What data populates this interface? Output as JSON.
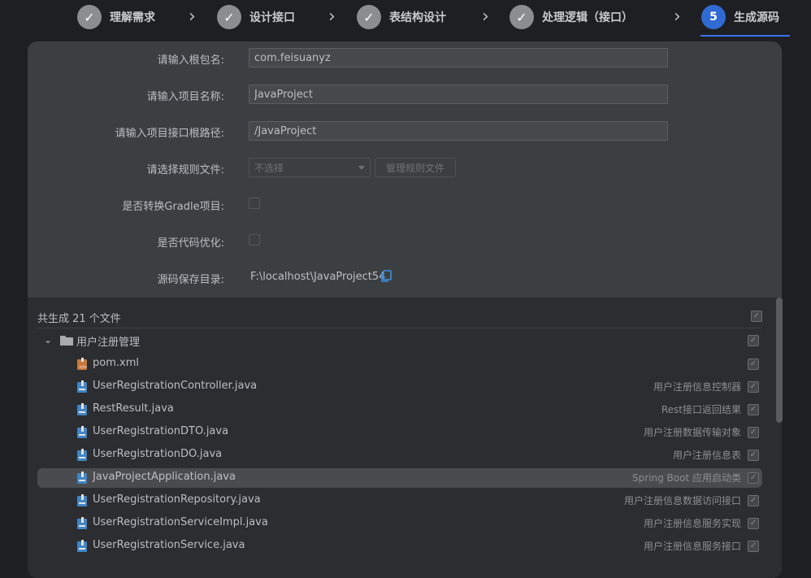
{
  "stepper": {
    "steps": [
      {
        "label": "理解需求",
        "mark": "✓"
      },
      {
        "label": "设计接口",
        "mark": "✓"
      },
      {
        "label": "表结构设计",
        "mark": "✓"
      },
      {
        "label": "处理逻辑（接口）",
        "mark": "✓"
      },
      {
        "label": "生成源码",
        "mark": "5"
      }
    ],
    "active_index": 4,
    "accent_color": "#2f6bd3"
  },
  "form": {
    "package_label": "请输入根包名:",
    "package_value": "com.feisuanyz",
    "project_label": "请输入项目名称:",
    "project_value": "JavaProject",
    "root_path_label": "请输入项目接口根路径:",
    "root_path_value": "/JavaProject",
    "rule_file_label": "请选择规则文件:",
    "rule_file_placeholder": "不选择",
    "manage_rules_button": "管理规则文件",
    "gradle_label": "是否转换Gradle项目:",
    "optimize_label": "是否代码优化:",
    "save_dir_label": "源码保存目录:",
    "save_dir_value": "F:\\localhost\\JavaProject54"
  },
  "files": {
    "summary": "共生成 21 个文件",
    "folder_name": "用户注册管理",
    "items": [
      {
        "name": "pom.xml",
        "desc": "",
        "icon": "xml-file-icon"
      },
      {
        "name": "UserRegistrationController.java",
        "desc": "用户注册信息控制器",
        "icon": "java-file-icon"
      },
      {
        "name": "RestResult.java",
        "desc": "Rest接口返回结果",
        "icon": "java-file-icon"
      },
      {
        "name": "UserRegistrationDTO.java",
        "desc": "用户注册数据传输对象",
        "icon": "java-file-icon"
      },
      {
        "name": "UserRegistrationDO.java",
        "desc": "用户注册信息表",
        "icon": "java-file-icon"
      },
      {
        "name": "JavaProjectApplication.java",
        "desc": "Spring Boot 应用启动类",
        "icon": "java-file-icon"
      },
      {
        "name": "UserRegistrationRepository.java",
        "desc": "用户注册信息数据访问接口",
        "icon": "java-file-icon"
      },
      {
        "name": "UserRegistrationServiceImpl.java",
        "desc": "用户注册信息服务实现",
        "icon": "java-file-icon"
      },
      {
        "name": "UserRegistrationService.java",
        "desc": "用户注册信息服务接口",
        "icon": "java-file-icon"
      }
    ],
    "selected_index": 5
  }
}
